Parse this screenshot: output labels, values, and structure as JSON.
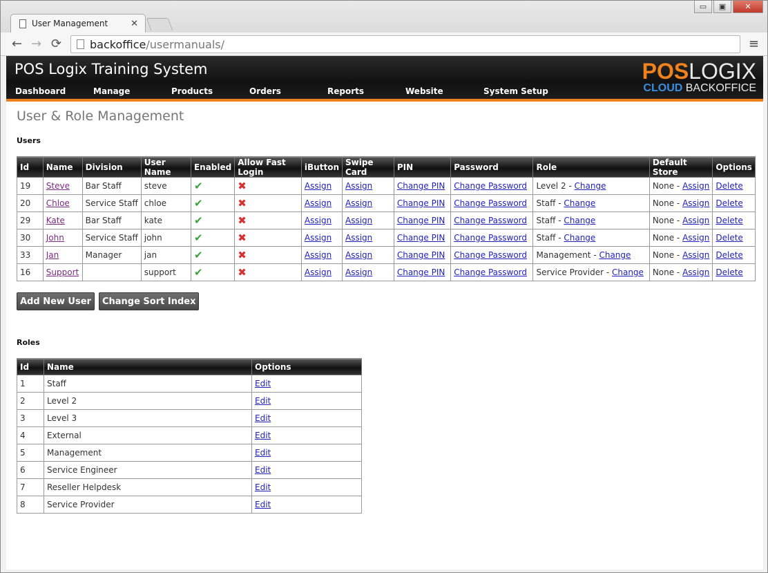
{
  "browser": {
    "tab_title": "User Management",
    "url_host": "backoffice",
    "url_path": "/usermanuals/",
    "tab_close": "✕",
    "win_minimize": "▭",
    "win_maximize": "▣",
    "win_close": "✕",
    "back_glyph": "←",
    "forward_glyph": "→",
    "reload_glyph": "⟳",
    "menu_glyph": "≡"
  },
  "header": {
    "site_title": "POS Logix Training System",
    "logo_pos": "POS",
    "logo_logix": "LOGIX",
    "logo_cloud": "CLOUD",
    "logo_backoffice": " BACKOFFICE",
    "nav": [
      "Dashboard",
      "Manage",
      "Products",
      "Orders",
      "Reports",
      "Website",
      "System Setup"
    ]
  },
  "main": {
    "page_title": "User & Role Management",
    "users_title": "Users",
    "roles_title": "Roles"
  },
  "users": {
    "columns": [
      "Id",
      "Name",
      "Division",
      "User Name",
      "Enabled",
      "Allow Fast Login",
      "iButton",
      "Swipe Card",
      "PIN",
      "Password",
      "Role",
      "Default Store",
      "Options"
    ],
    "rows": [
      {
        "id": "19",
        "name": "Steve",
        "division": "Bar Staff",
        "username": "steve",
        "role": "Level 2 - "
      },
      {
        "id": "20",
        "name": "Chloe",
        "division": "Service Staff",
        "username": "chloe",
        "role": "Staff - "
      },
      {
        "id": "29",
        "name": "Kate",
        "division": "Bar Staff",
        "username": "kate",
        "role": "Staff - "
      },
      {
        "id": "30",
        "name": "John",
        "division": "Service Staff",
        "username": "john",
        "role": "Staff - "
      },
      {
        "id": "33",
        "name": "Jan",
        "division": "Manager",
        "username": "jan",
        "role": "Management - "
      },
      {
        "id": "16",
        "name": "Support",
        "division": "",
        "username": "support",
        "role": "Service Provider - "
      }
    ],
    "enabled_glyph": "✔",
    "fast_login_glyph": "✖",
    "assign_label": "Assign",
    "change_pin_label": "Change PIN",
    "change_password_label": "Change Password",
    "change_label": "Change",
    "default_store_text": "None - ",
    "delete_label": "Delete"
  },
  "buttons": {
    "add_new_user": "Add New User",
    "change_sort_index": "Change Sort Index"
  },
  "roles": {
    "columns": [
      "Id",
      "Name",
      "Options"
    ],
    "rows": [
      {
        "id": "1",
        "name": "Staff"
      },
      {
        "id": "2",
        "name": "Level 2"
      },
      {
        "id": "3",
        "name": "Level 3"
      },
      {
        "id": "4",
        "name": "External"
      },
      {
        "id": "5",
        "name": "Management"
      },
      {
        "id": "6",
        "name": "Service Engineer"
      },
      {
        "id": "7",
        "name": "Reseller Helpdesk"
      },
      {
        "id": "8",
        "name": "Service Provider"
      }
    ],
    "edit_label": "Edit"
  },
  "colors": {
    "accent_orange": "#f0821e",
    "logo_blue": "#3a8ee0",
    "link_blue": "#2222bb",
    "visited_purple": "#7a2a82",
    "enabled_green": "#3aa33a",
    "disabled_red": "#d93030"
  }
}
